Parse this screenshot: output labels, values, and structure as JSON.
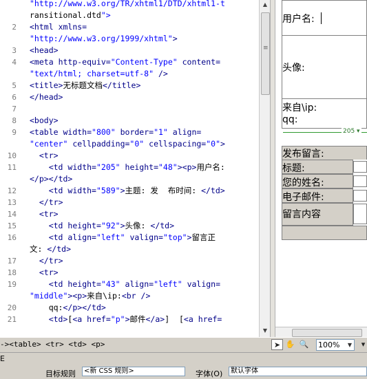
{
  "code_lines": [
    {
      "num": "",
      "text": "\"http://www.w3.org/TR/xhtml1/DTD/xhtml1-t"
    },
    {
      "num": "",
      "text": "ransitional.dtd\">"
    },
    {
      "num": "2",
      "text": "<html xmlns="
    },
    {
      "num": "",
      "text": "\"http://www.w3.org/1999/xhtml\">"
    },
    {
      "num": "3",
      "text": "<head>"
    },
    {
      "num": "4",
      "text": "<meta http-equiv=\"Content-Type\" content="
    },
    {
      "num": "",
      "text": "\"text/html; charset=utf-8\" />"
    },
    {
      "num": "5",
      "text": "<title>无标题文档</title>"
    },
    {
      "num": "6",
      "text": "</head>"
    },
    {
      "num": "7",
      "text": ""
    },
    {
      "num": "8",
      "text": "<body>"
    },
    {
      "num": "9",
      "text": "<table width=\"800\" border=\"1\" align="
    },
    {
      "num": "",
      "text": "\"center\" cellpadding=\"0\" cellspacing=\"0\">"
    },
    {
      "num": "10",
      "text": "  <tr>"
    },
    {
      "num": "11",
      "text": "    <td width=\"205\" height=\"48\"><p>用户名:"
    },
    {
      "num": "",
      "text": "</p></td>"
    },
    {
      "num": "12",
      "text": "    <td width=\"589\">主题: 发  布时间: </td>"
    },
    {
      "num": "13",
      "text": "  </tr>"
    },
    {
      "num": "14",
      "text": "  <tr>"
    },
    {
      "num": "15",
      "text": "    <td height=\"92\">头像: </td>"
    },
    {
      "num": "16",
      "text": "    <td align=\"left\" valign=\"top\">留言正"
    },
    {
      "num": "",
      "text": "文: </td>"
    },
    {
      "num": "17",
      "text": "  </tr>"
    },
    {
      "num": "18",
      "text": "  <tr>"
    },
    {
      "num": "19",
      "text": "    <td height=\"43\" align=\"left\" valign="
    },
    {
      "num": "",
      "text": "\"middle\"><p>来自\\ip:<br />"
    },
    {
      "num": "20",
      "text": "    qq:</p></td>"
    },
    {
      "num": "21",
      "text": "    <td>[<a href=\"p\">邮件</a>]  [<a href="
    }
  ],
  "design": {
    "username_label": "用户名:",
    "avatar_label": "头像:",
    "from_ip_label": "来自\\ip:",
    "qq_label": "qq:",
    "width_indicator": "205",
    "post_message_label": "发布留言:",
    "title_label": "标题:",
    "your_name_label": "您的姓名:",
    "email_label": "电子邮件:",
    "message_content_label": "留言内容"
  },
  "status": {
    "tag_selector": "<table> <tr> <td> <p>",
    "zoom": "100%"
  },
  "properties": {
    "target_rule_label": "目标规则",
    "target_rule_value": "<新 CSS 规则>",
    "font_label": "字体(O)",
    "font_value": "默认字体"
  },
  "colors": {
    "tag": "#000088",
    "string": "#0000ff",
    "dimension": "#2e9a2e"
  }
}
